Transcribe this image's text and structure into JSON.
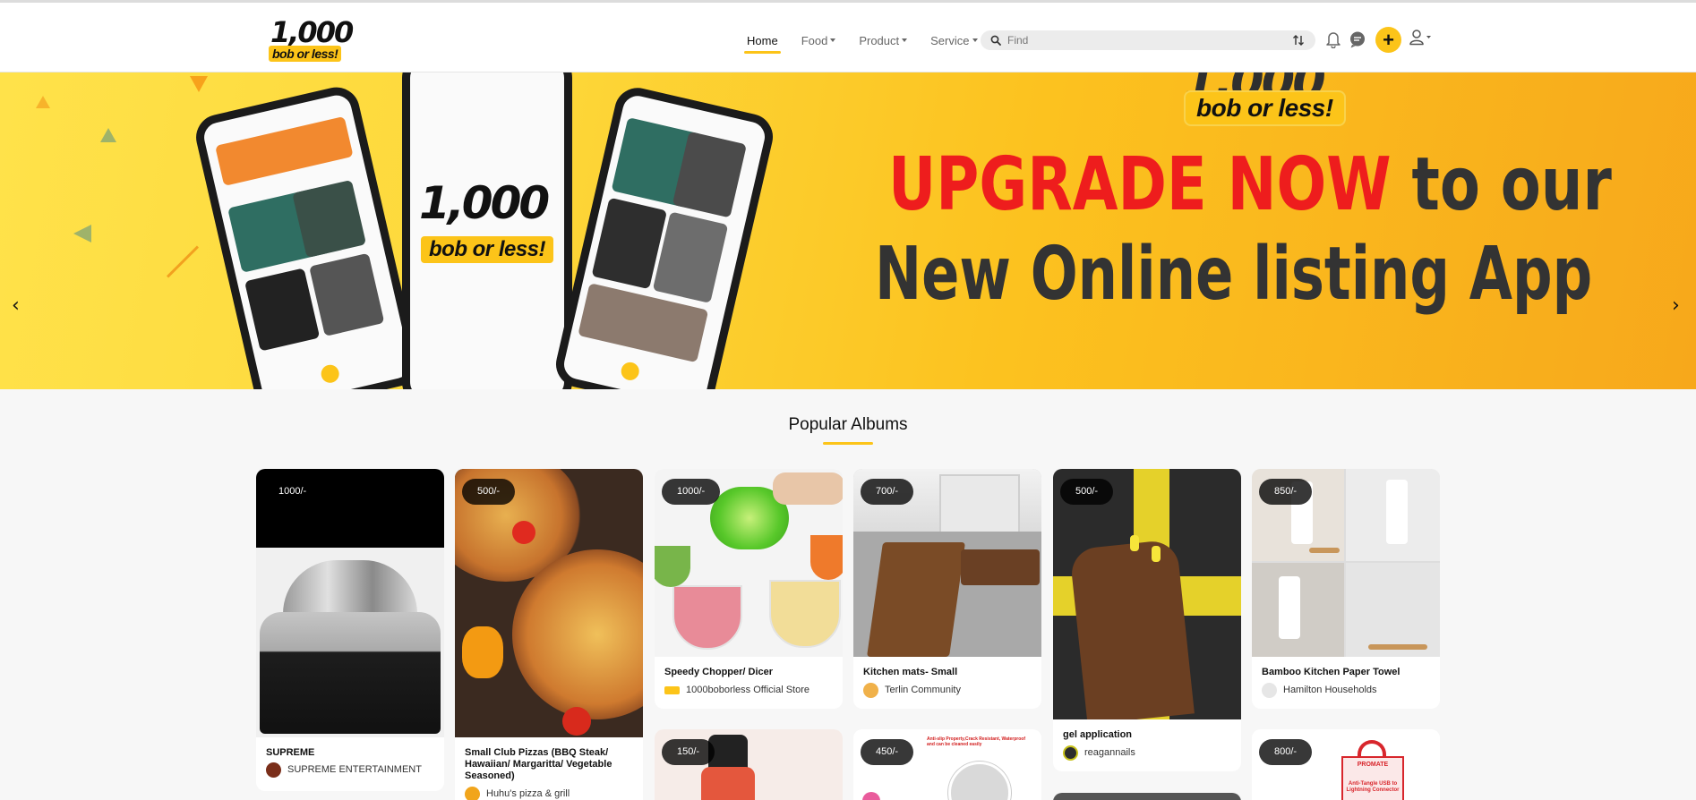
{
  "header": {
    "logo": {
      "number": "1,000",
      "tagline": "bob or less!"
    },
    "nav": [
      {
        "label": "Home",
        "active": true,
        "dropdown": false
      },
      {
        "label": "Food",
        "active": false,
        "dropdown": true
      },
      {
        "label": "Product",
        "active": false,
        "dropdown": true
      },
      {
        "label": "Service",
        "active": false,
        "dropdown": true
      }
    ],
    "search": {
      "placeholder": "Find",
      "value": ""
    },
    "icons": [
      "search-icon",
      "sort-icon",
      "bell-icon",
      "chat-icon",
      "plus-icon",
      "user-icon"
    ],
    "plus_label": "+"
  },
  "banner": {
    "logo_number": "1,000",
    "logo_tagline": "bob or less!",
    "headline_highlight": "UPGRADE NOW",
    "headline_rest": "to our",
    "headline_line2": "New Online listing App",
    "phone_logo_number": "1,000",
    "phone_logo_tagline": "bob or less!",
    "prev_arrow": "‹",
    "next_arrow": "›"
  },
  "section": {
    "title": "Popular Albums"
  },
  "albums": [
    {
      "price": "1000/-",
      "title": "SUPREME",
      "seller": "SUPREME ENTERTAINMENT"
    },
    {
      "price": "500/-",
      "title": "Small Club Pizzas (BBQ Steak/ Hawaiian/ Margaritta/ Vegetable Seasoned)",
      "seller": "Huhu's pizza & grill"
    },
    {
      "price": "1000/-",
      "title": "Speedy Chopper/ Dicer",
      "seller": "1000boborless Official Store"
    },
    {
      "price": "700/-",
      "title": "Kitchen mats- Small",
      "seller": "Terlin Community"
    },
    {
      "price": "500/-",
      "title": "gel application",
      "seller": "reagannails"
    },
    {
      "price": "850/-",
      "title": "Bamboo Kitchen Paper Towel",
      "seller": "Hamilton Households"
    },
    {
      "price": "150/-"
    },
    {
      "price": "450/-",
      "image_text": "Anti-slip Property,Crack Resistant, Waterproof and can be cleaned easily"
    },
    {
      "price": "800/-",
      "image_text_brand": "PROMATE",
      "image_text": "Anti-Tangle USB to Lightning Connector"
    }
  ],
  "colors": {
    "accent": "#fcc419",
    "headline_red": "#ee1d1d",
    "text_dark": "#333333"
  }
}
